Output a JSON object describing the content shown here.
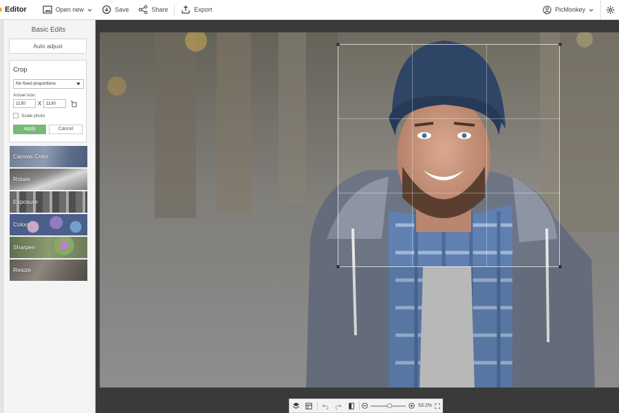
{
  "app": {
    "title": "Editor"
  },
  "toolbar": {
    "open_new_label": "Open new",
    "save_label": "Save",
    "share_label": "Share",
    "export_label": "Export",
    "account_label": "PicMonkey"
  },
  "panel": {
    "heading": "Basic Edits",
    "auto_adjust_label": "Auto adjust",
    "crop": {
      "title": "Crop",
      "proportion_value": "No fixed proportions",
      "actual_size_label": "Actual size:",
      "width_value": "1130",
      "height_value": "1130",
      "x_separator": "X",
      "scale_label": "Scale photo",
      "apply_label": "Apply",
      "cancel_label": "Cancel"
    },
    "tools": [
      {
        "label": "Canvas Color"
      },
      {
        "label": "Rotate"
      },
      {
        "label": "Exposure"
      },
      {
        "label": "Colors"
      },
      {
        "label": "Sharpen"
      },
      {
        "label": "Resize"
      }
    ]
  },
  "zoom": {
    "level": "53.2%",
    "slider_fraction": 0.5
  },
  "colors": {
    "apply_green": "#79b877",
    "workspace": "#3a3a3a"
  }
}
